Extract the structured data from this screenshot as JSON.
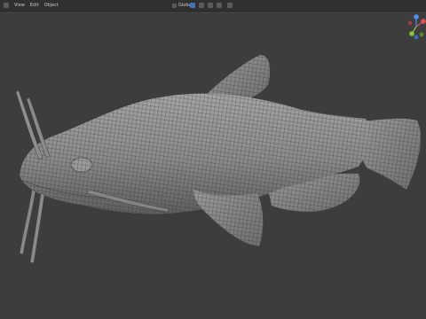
{
  "header": {
    "menu_items": [
      "View",
      "Edit",
      "Object"
    ],
    "mode_label": "Global",
    "pivot_icon": "transform-pivot-icon",
    "snap_icon": "magnet-icon",
    "proportional_icon": "proportional-edit-icon",
    "shading_icon": "solid-shading-icon"
  },
  "colors": {
    "background": "#3d3d3d",
    "header": "#303030",
    "mesh_base": "#8b8b8b",
    "wireframe": "#2e2e2e",
    "axis_x": "#e0505c",
    "axis_y": "#8ac43d",
    "axis_z": "#4f8fe8"
  }
}
